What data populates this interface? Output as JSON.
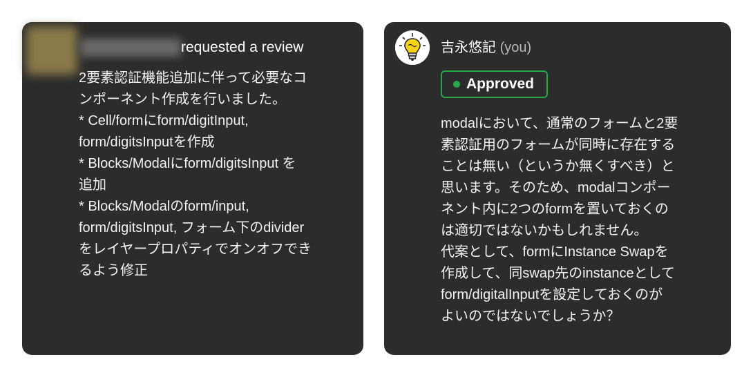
{
  "left_card": {
    "action_text": "requested a review",
    "comment": "2要素認証機能追加に伴って必要なコ\nンポーネント作成を行いました。\n* Cell/formにform/digitInput,\nform/digitsInputを作成\n* Blocks/Modalにform/digitsInput を\n追加\n* Blocks/Modalのform/input,\nform/digitsInput, フォーム下のdivider\nをレイヤープロパティでオンオフでき\nるよう修正"
  },
  "right_card": {
    "reviewer_name": "吉永悠記",
    "reviewer_suffix": "(you)",
    "status_label": "Approved",
    "comment": "modalにおいて、通常のフォームと2要\n素認証用のフォームが同時に存在する\nことは無い（というか無くすべき）と\n思います。そのため、modalコンポー\nネント内に2つのformを置いておくの\nは適切ではないかもしれません。\n代案として、formにInstance Swapを\n作成して、同swap先のinstanceとして\nform/digitalInputを設定しておくのが\nよいのではないでしょうか？"
  },
  "colors": {
    "card_background": "#2c2c2c",
    "approved_green": "#27a74a"
  },
  "icons": {
    "reviewer_avatar": "lightbulb-icon"
  }
}
